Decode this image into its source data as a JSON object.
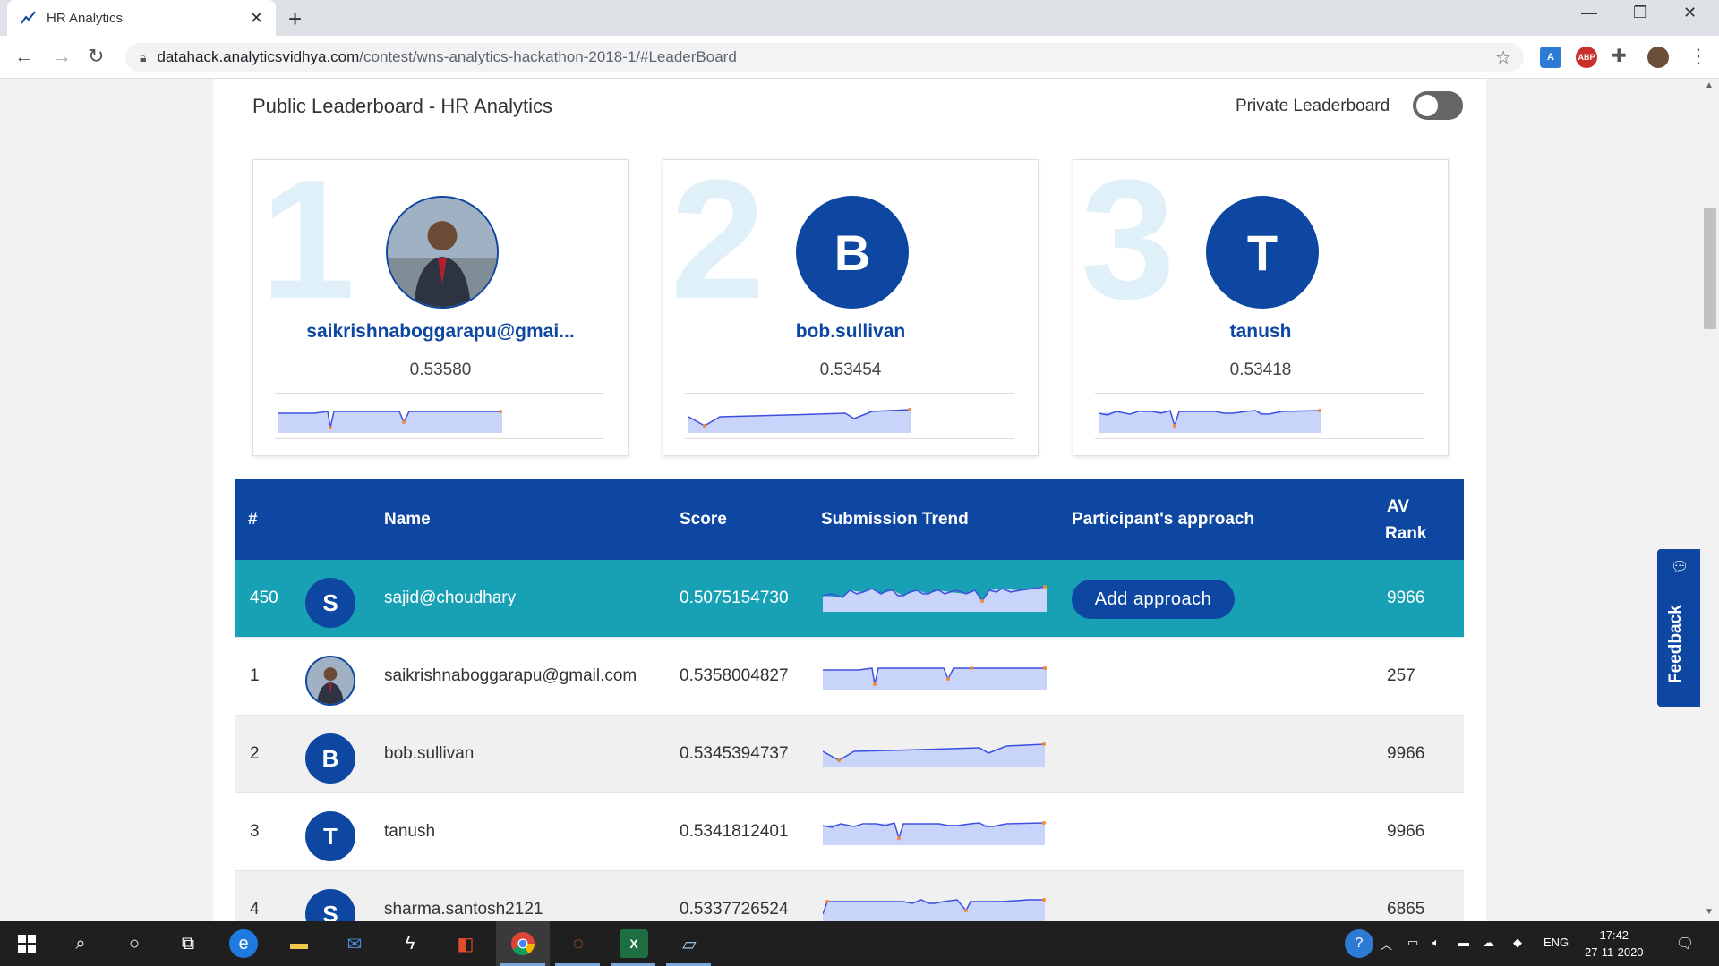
{
  "browser": {
    "tab_title": "HR Analytics",
    "tab_close": "✕",
    "new_tab": "+",
    "url_domain": "datahack.analyticsvidhya.com",
    "url_path": "/contest/wns-analytics-hackathon-2018-1/#LeaderBoard",
    "extensions": [
      {
        "name": "translate-ext",
        "color": "#2e7bd6",
        "label": "A"
      },
      {
        "name": "adblock-ext",
        "color": "#c9302c",
        "label": "ABP"
      }
    ]
  },
  "page": {
    "title": "Public Leaderboard - HR Analytics",
    "private_label": "Private Leaderboard",
    "private_enabled": false
  },
  "podium": [
    {
      "rank": "1",
      "initial": "",
      "photo": true,
      "name": "saikrishnaboggarapu@gmai...",
      "score": "0.53580"
    },
    {
      "rank": "2",
      "initial": "B",
      "photo": false,
      "name": "bob.sullivan",
      "score": "0.53454"
    },
    {
      "rank": "3",
      "initial": "T",
      "photo": false,
      "name": "tanush",
      "score": "0.53418"
    }
  ],
  "table": {
    "headers": {
      "rank": "#",
      "name": "Name",
      "score": "Score",
      "trend": "Submission Trend",
      "approach": "Participant's approach",
      "av_rank_1": "AV",
      "av_rank_2": "Rank"
    },
    "rows": [
      {
        "rank": "450",
        "initial": "S",
        "photo": false,
        "name": "sajid@choudhary",
        "score": "0.5075154730",
        "approach": "Add approach",
        "av_rank": "9966",
        "style": "highlight"
      },
      {
        "rank": "1",
        "initial": "",
        "photo": true,
        "name": "saikrishnaboggarapu@gmail.com",
        "score": "0.5358004827",
        "approach": "",
        "av_rank": "257",
        "style": "normal"
      },
      {
        "rank": "2",
        "initial": "B",
        "photo": false,
        "name": "bob.sullivan",
        "score": "0.5345394737",
        "approach": "",
        "av_rank": "9966",
        "style": "alt"
      },
      {
        "rank": "3",
        "initial": "T",
        "photo": false,
        "name": "tanush",
        "score": "0.5341812401",
        "approach": "",
        "av_rank": "9966",
        "style": "normal"
      },
      {
        "rank": "4",
        "initial": "S",
        "photo": false,
        "name": "sharma.santosh2121",
        "score": "0.5337726524",
        "approach": "",
        "av_rank": "6865",
        "style": "alt"
      }
    ]
  },
  "feedback": {
    "label": "Feedback"
  },
  "taskbar": {
    "lang": "ENG",
    "time": "17:42",
    "date": "27-11-2020",
    "notifications": "1"
  },
  "colors": {
    "primary": "#0e47a1",
    "highlight": "#18a0b5",
    "rank_watermark": "#dff0f8",
    "spark_line": "#3d4fe0",
    "spark_fill": "#c9d4fb",
    "spark_dot": "#f0883e"
  }
}
